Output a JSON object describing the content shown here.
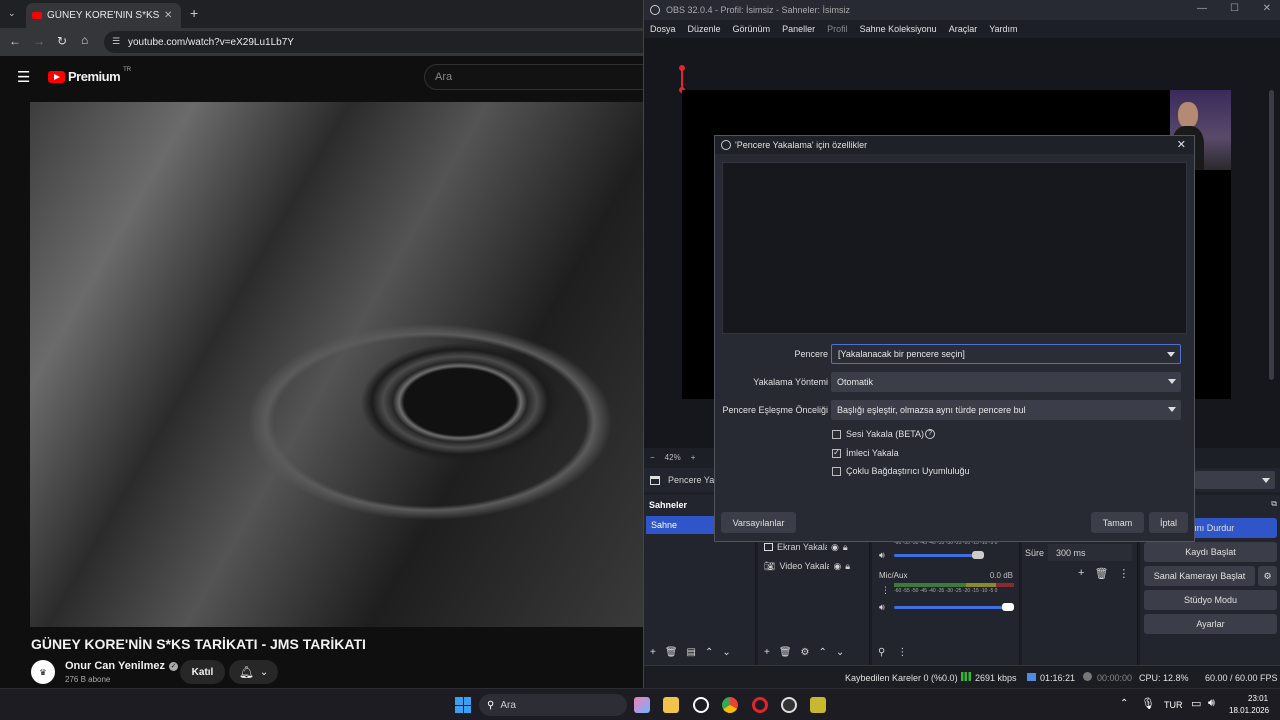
{
  "browser": {
    "tab_title": "GÜNEY KORE'NİN S*KS TARİKATI",
    "url": "youtube.com/watch?v=eX29Lu1Lb7Y",
    "youtube": {
      "logo_text": "Premium",
      "region": "TR",
      "search_placeholder": "Ara",
      "video_title": "GÜNEY KORE'NİN S*KS TARİKATI - JMS TARİKATI",
      "channel_name": "Onur Can Yenilmez",
      "subscribers": "276 B abone",
      "join_label": "Katıl"
    }
  },
  "obs": {
    "window_title": "OBS 32.0.4 - Profil: İsimsiz - Sahneler: İsimsiz",
    "menu": [
      "Dosya",
      "Düzenle",
      "Görünüm",
      "Paneller",
      "Profil",
      "Sahne Koleksiyonu",
      "Araçlar",
      "Yardım"
    ],
    "zoom": "42%",
    "source_bar_label": "Pencere Yal",
    "scenes": {
      "header": "Sahneler",
      "items": [
        "Sahne"
      ]
    },
    "sources": [
      "Ekran Yakala",
      "Video Yakala"
    ],
    "mixer": {
      "channel": "Mic/Aux",
      "level": "0.0 dB",
      "meter_ticks": "-60 -55 -50 -45 -40 -35 -30 -25 -20 -15 -10 -5 0"
    },
    "transition": {
      "duration_label": "Süre",
      "duration_value": "300 ms"
    },
    "controls": [
      "...ını Durdur",
      "Kaydı Başlat",
      "Sanal Kamerayı Başlat",
      "Stüdyo Modu",
      "Ayarlar"
    ],
    "status": {
      "dropped": "Kaybedilen Kareler 0 (%0.0)",
      "bitrate": "2691 kbps",
      "stream_time": "01:16:21",
      "rec_time": "00:00:00",
      "cpu": "CPU: 12.8%",
      "fps": "60.00 / 60.00 FPS"
    }
  },
  "dialog": {
    "title": "'Pencere Yakalama' için özellikler",
    "fields": {
      "window_label": "Pencere",
      "window_value": "[Yakalanacak bir pencere seçin]",
      "method_label": "Yakalama Yöntemi",
      "method_value": "Otomatik",
      "priority_label": "Pencere Eşleşme Önceliği",
      "priority_value": "Başlığı eşleştir, olmazsa aynı türde pencere bul"
    },
    "checkboxes": [
      {
        "label": "Sesi Yakala (BETA)",
        "checked": false
      },
      {
        "label": "İmleci Yakala",
        "checked": true
      },
      {
        "label": "Çoklu Bağdaştırıcı Uyumluluğu",
        "checked": false
      }
    ],
    "buttons": {
      "defaults": "Varsayılanlar",
      "ok": "Tamam",
      "cancel": "İptal"
    }
  },
  "taskbar": {
    "search_placeholder": "Ara",
    "language": "TUR",
    "time": "23:01",
    "date": "18.01.2026"
  }
}
